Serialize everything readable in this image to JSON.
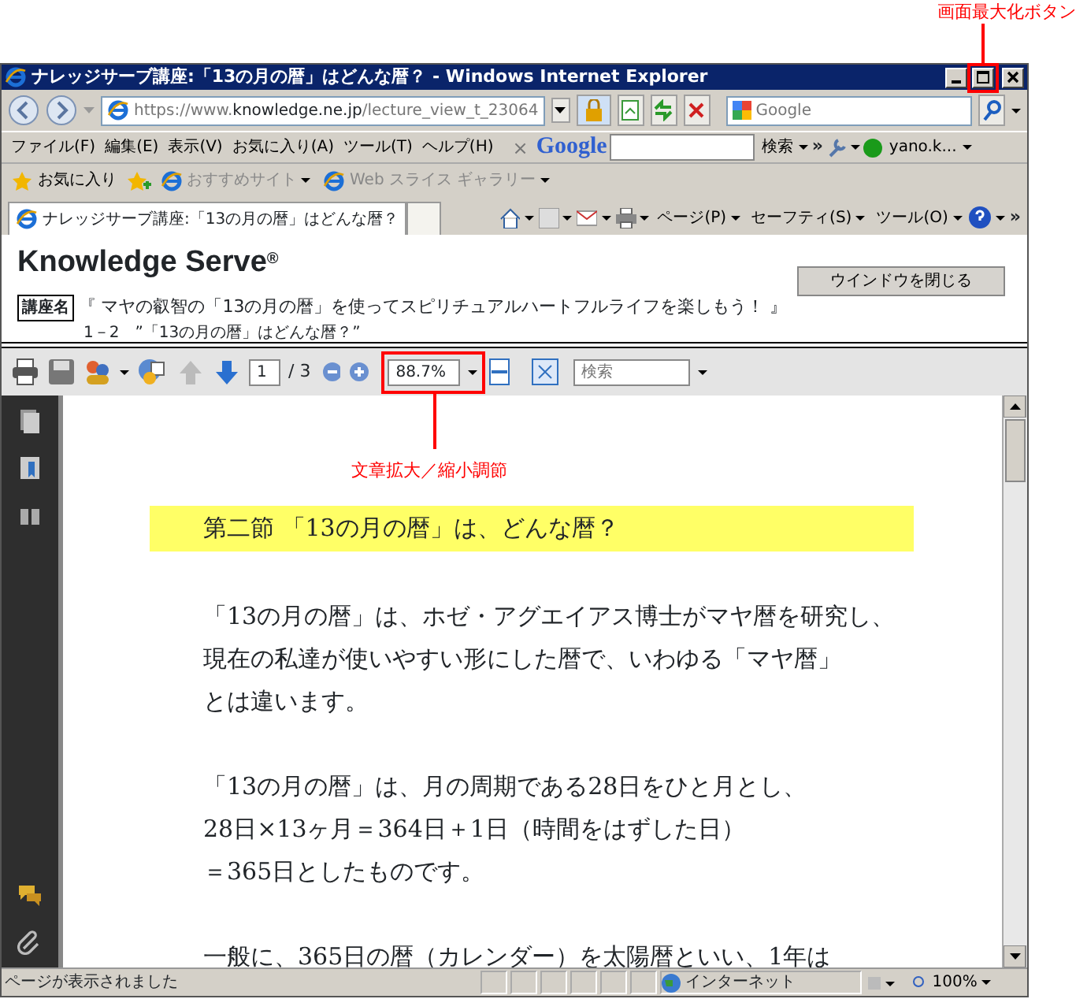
{
  "annotations": {
    "maximize_button": "画面最大化ボタン",
    "zoom_field": "文章拡大／縮小調節"
  },
  "window": {
    "title": "ナレッジサーブ講座:「13の月の暦」はどんな暦？ - Windows Internet Explorer"
  },
  "address_bar": {
    "url": {
      "scheme": "https://www.",
      "domain": "knowledge.ne.jp",
      "path": "/lecture_view_t_23064"
    },
    "search_placeholder": "Google"
  },
  "menu": [
    "ファイル(F)",
    "編集(E)",
    "表示(V)",
    "お気に入り(A)",
    "ツール(T)",
    "ヘルプ(H)"
  ],
  "google_toolbar": {
    "close": "×",
    "logo": "Google",
    "search_button": "検索",
    "more": "»",
    "account": "yano.k..."
  },
  "favorites_bar": [
    {
      "label": "お気に入り",
      "disabled": false
    },
    {
      "label": "おすすめサイト",
      "disabled": true
    },
    {
      "label": "Web スライス ギャラリー",
      "disabled": true
    }
  ],
  "tabs": [
    {
      "label": "ナレッジサーブ講座:「13の月の暦」はどんな暦？",
      "selected": true
    }
  ],
  "command_bar": [
    "ページ(P)",
    "セーフティ(S)",
    "ツール(O)"
  ],
  "command_more": "»",
  "page": {
    "brand": "Knowledge Serve$^{®}$",
    "close_button": "ウインドウを閉じる",
    "course_label": "講座名",
    "course_title": "『 マヤの叡智の「13の月の暦」を使ってスピリチュアルハートフルライフを楽しもう！ 』",
    "lesson": "1－2　”「13の月の暦」はどんな暦？”"
  },
  "pdf_toolbar": {
    "page": "1",
    "total": "/ 3",
    "zoom": "88.7%",
    "search_placeholder": "検索"
  },
  "document": {
    "heading": "第二節 「13の月の暦」は、どんな暦？",
    "paragraphs": [
      [
        "「13の月の暦」は、ホゼ・アグエイアス博士がマヤ暦を研究し、",
        "現在の私達が使いやすい形にした暦で、いわゆる「マヤ暦」",
        "とは違います。"
      ],
      [
        "「13の月の暦」は、月の周期である28日をひと月とし、",
        "28日×13ヶ月＝364日＋1日（時間をはずした日）",
        "＝365日としたものです。"
      ],
      [
        "一般に、365日の暦（カレンダー）を太陽暦といい、1年は"
      ]
    ]
  },
  "status_bar": {
    "message": "ページが表示されました",
    "zone": "インターネット",
    "zoom": "100%"
  }
}
